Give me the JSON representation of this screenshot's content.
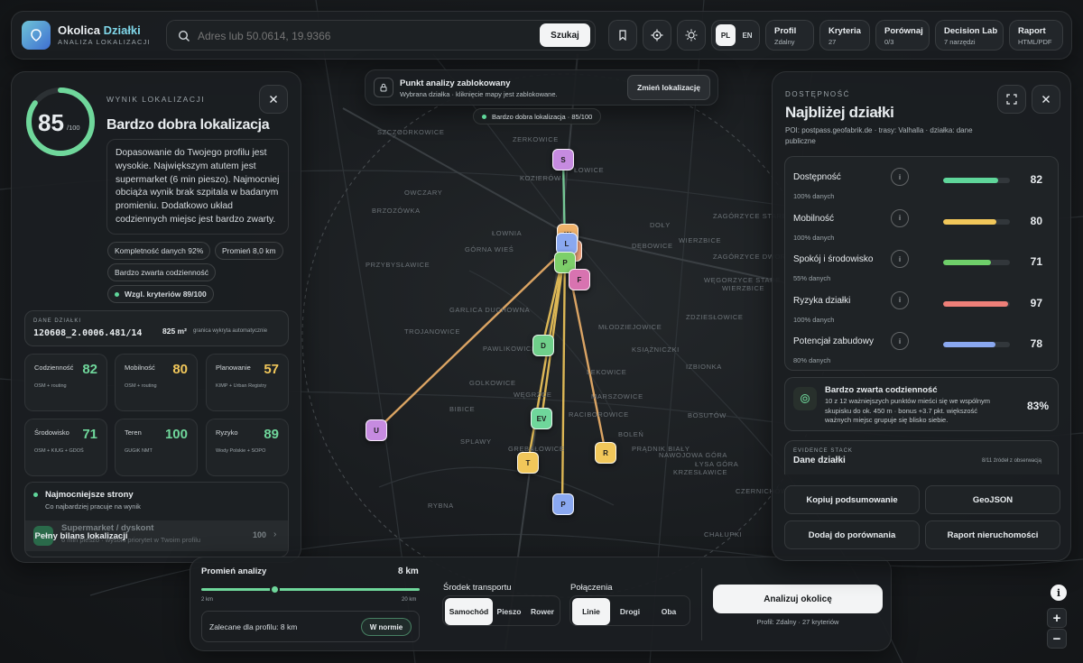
{
  "app": {
    "name_part1": "Okolica",
    "name_part2": "Działki",
    "subtitle": "ANALIZA LOKALIZACJI"
  },
  "search": {
    "placeholder": "Adres lub 50.0614, 19.9366",
    "button": "Szukaj"
  },
  "lang": {
    "active": "PL",
    "other": "EN"
  },
  "toolbar": [
    {
      "title": "Profil",
      "sub": "Zdalny"
    },
    {
      "title": "Kryteria",
      "sub": "27"
    },
    {
      "title": "Porównaj",
      "sub": "0/3"
    },
    {
      "title": "Decision Lab",
      "sub": "7 narzędzi"
    },
    {
      "title": "Raport",
      "sub": "HTML/PDF"
    }
  ],
  "lock_banner": {
    "title": "Punkt analizy zablokowany",
    "text": "Wybrana działka · kliknięcie mapy jest zablokowane.",
    "button": "Zmień lokalizację",
    "badge": "Bardzo dobra lokalizacja · 85/100"
  },
  "score": {
    "section": "WYNIK LOKALIZACJI",
    "value": "85",
    "max": "/100",
    "level": 0.85,
    "title": "Bardzo dobra lokalizacja",
    "description": "Dopasowanie do Twojego profilu jest wysokie. Największym atutem jest supermarket (6 min pieszo). Najmocniej obciąża wynik brak szpitala w badanym promieniu. Dodatkowo układ codziennych miejsc jest bardzo zwarty.",
    "chips": [
      "Kompletność danych 92%",
      "Promień 8,0 km",
      "Bardzo zwarta codzienność",
      "Wzgl. kryteriów 89/100"
    ]
  },
  "parcel": {
    "label": "DANE DZIAŁKI",
    "id": "120608_2.0006.481/14",
    "area": "825 m²",
    "area_note": "granica wykryta automatycznie"
  },
  "subscores": [
    {
      "name": "Codzienność",
      "value": "82",
      "source": "OSM + routing",
      "color": "#6fd79b"
    },
    {
      "name": "Mobilność",
      "value": "80",
      "source": "OSM + routing",
      "color": "#f1c75a"
    },
    {
      "name": "Planowanie",
      "value": "57",
      "source": "KIMP + Urban Registry",
      "color": "#f1c75a"
    },
    {
      "name": "Środowisko",
      "value": "71",
      "source": "OSM + KIUG + GDOŚ",
      "color": "#6fd79b"
    },
    {
      "name": "Teren",
      "value": "100",
      "source": "GUGiK NMT",
      "color": "#6fd79b"
    },
    {
      "name": "Ryzyko",
      "value": "89",
      "source": "Wody Polskie + SOPO",
      "color": "#6fd79b"
    }
  ],
  "strengths": {
    "title": "Najmocniejsze strony",
    "subtitle": "Co najbardziej pracuje na wynik",
    "item_title": "Supermarket / dyskont",
    "item_sub": "6 min pieszo · wysoki priorytet w Twoim profilu",
    "item_value": "100",
    "overlay": "Pełny bilans lokalizacji"
  },
  "radius": {
    "label": "Promień analizy",
    "value": "8 km",
    "min": "2 km",
    "max": "20 km",
    "level": 0.333,
    "hint": "Zalecane dla profilu: 8 km",
    "badge": "W normie"
  },
  "transport": {
    "label": "Środek transportu",
    "options": [
      "Samochód",
      "Pieszo",
      "Rower"
    ],
    "selected": "Samochód"
  },
  "connections": {
    "label": "Połączenia",
    "options": [
      "Linie",
      "Drogi",
      "Oba"
    ],
    "selected": "Linie"
  },
  "analyze": {
    "button": "Analizuj okolicę",
    "note": "Profil: Zdalny · 27 kryteriów"
  },
  "access": {
    "section": "DOSTĘPNOŚĆ",
    "title": "Najbliżej działki",
    "sources": "POI: postpass.geofabrik.de · trasy: Valhalla · działka: dane publiczne",
    "criteria": [
      {
        "name": "Dostępność",
        "sub": "100% danych",
        "value": "82",
        "fill": 0.82,
        "color": "#5fd69a"
      },
      {
        "name": "Mobilność",
        "sub": "100% danych",
        "value": "80",
        "fill": 0.8,
        "color": "#f1c75a"
      },
      {
        "name": "Spokój i środowisko",
        "sub": "55% danych",
        "value": "71",
        "fill": 0.71,
        "color": "#6fcf6a"
      },
      {
        "name": "Ryzyka działki",
        "sub": "100% danych",
        "value": "97",
        "fill": 0.97,
        "color": "#ee7f78"
      },
      {
        "name": "Potencjał zabudowy",
        "sub": "80% danych",
        "value": "78",
        "fill": 0.78,
        "color": "#8aa8f0"
      }
    ],
    "compact": {
      "title": "Bardzo zwarta codzienność",
      "text": "10 z 12 ważniejszych punktów mieści się we wspólnym skupisku do ok. 450 m · bonus +3.7 pkt. większość ważnych miejsc grupuje się blisko siebie.",
      "value": "83%"
    },
    "evidence": {
      "label": "EVIDENCE STACK",
      "title": "Dane działki",
      "note": "8/11 źródeł z obserwacją"
    },
    "actions": [
      "Kopiuj podsumowanie",
      "GeoJSON",
      "Dodaj do porównania",
      "Raport nieruchomości"
    ]
  },
  "districts": [
    "SZCZODRKOWICE",
    "ZERKOWICE",
    "KOZIERÓW",
    "ŁOWICE",
    "OWCZARY",
    "BRZOZÓWKA",
    "ŁOWNIA",
    "DOŁY",
    "ZAGÓRZYCE STARE",
    "PRZYBYSŁAWICE",
    "GÓRNA WIEŚ",
    "DĘBOWICE",
    "WIERZBICE",
    "ZAGÓRZYCE DWORSKIE",
    "WĘGORZYCE STARE",
    "GARLICA DUCHOWNA",
    "WIERZBICE",
    "ZDZIESŁOWICE",
    "TROJANOWICE",
    "MŁODZIEJOWICE",
    "KSIĄŻNICZKI",
    "IZBIONKA",
    "PAWLIKOWICE",
    "GOLKOWICE",
    "LEKOWICE",
    "MARSZOWICE",
    "BIBICE",
    "WĘGRZCE",
    "RACIBOROWICE",
    "BOSUTÓW",
    "BOLEŃ",
    "NAWOJOWA GÓRA",
    "ŁYSA GÓRA",
    "SPLAWY",
    "GRĘBAŁOWICE",
    "PRĄDNIK BIAŁY",
    "KRZESŁAWICE",
    "RYBNA",
    "CZERNICHÓW",
    "CHAŁUPKI"
  ],
  "poi_markers": [
    "S",
    "W",
    "K",
    "L",
    "P",
    "F",
    "D",
    "EV",
    "U",
    "T",
    "R",
    "P"
  ]
}
